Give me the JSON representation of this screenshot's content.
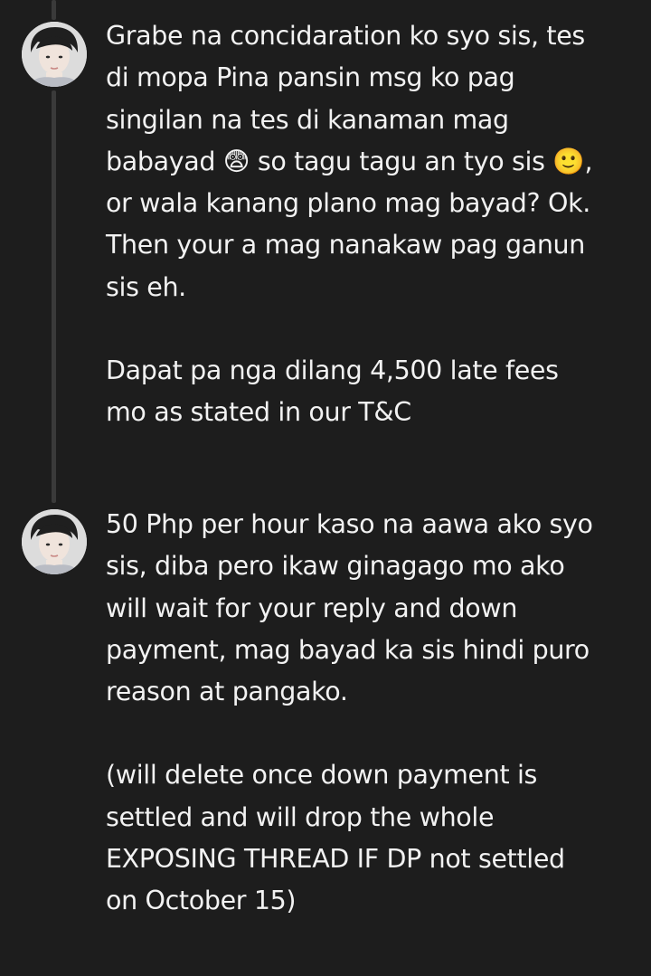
{
  "thread": {
    "tweets": [
      {
        "author_avatar": "profile-photo-icon",
        "paragraphs": [
          "Grabe na concidaration  ko syo sis, tes\ndi mopa Pina pansin msg ko pag\nsingilan na tes di kanaman mag\nbabayad 😨 so tagu tagu an tyo sis 🙂,\nor wala kanang plano mag bayad? Ok.\nThen your a mag nanakaw pag ganun\nsis eh.",
          "Dapat pa nga dilang 4,500 late fees\nmo as stated in our T&C"
        ]
      },
      {
        "author_avatar": "profile-photo-icon",
        "paragraphs": [
          "50 Php per hour kaso na aawa ako syo\nsis, diba pero ikaw ginagago mo ako\nwill wait for your reply and down\npayment, mag bayad ka sis hindi puro\nreason at pangako.",
          "(will delete once down payment is\nsettled and will drop the whole\nEXPOSING THREAD IF DP not settled\non October 15)"
        ]
      }
    ]
  },
  "colors": {
    "background": "#1d1d1d",
    "text": "#f2f2f2",
    "thread_line": "#3a3a3a"
  }
}
